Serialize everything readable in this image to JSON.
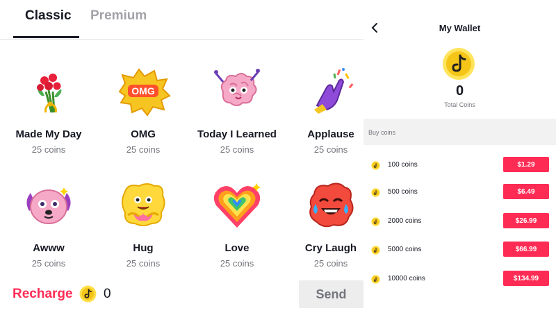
{
  "tabs": [
    {
      "label": "Classic",
      "active": true
    },
    {
      "label": "Premium",
      "active": false
    }
  ],
  "gifts": [
    {
      "name": "Made My Day",
      "price": "25 coins",
      "icon": "rose-bouquet-icon"
    },
    {
      "name": "OMG",
      "price": "25 coins",
      "icon": "omg-burst-icon"
    },
    {
      "name": "Today I Learned",
      "price": "25 coins",
      "icon": "brain-icon"
    },
    {
      "name": "Applause",
      "price": "25 coins",
      "icon": "clapping-hands-icon"
    },
    {
      "name": "Awww",
      "price": "25 coins",
      "icon": "puppy-icon"
    },
    {
      "name": "Hug",
      "price": "25 coins",
      "icon": "hug-icon"
    },
    {
      "name": "Love",
      "price": "25 coins",
      "icon": "rainbow-heart-icon"
    },
    {
      "name": "Cry Laugh",
      "price": "25 coins",
      "icon": "cry-laugh-icon"
    }
  ],
  "footer": {
    "recharge_label": "Recharge",
    "balance": "0",
    "send_label": "Send"
  },
  "wallet": {
    "title": "My Wallet",
    "balance": "0",
    "balance_label": "Total Coins",
    "buy_label": "Buy coins",
    "packages": [
      {
        "coins": "100 coins",
        "price": "$1.29"
      },
      {
        "coins": "500 coins",
        "price": "$6.49"
      },
      {
        "coins": "2000 coins",
        "price": "$26.99"
      },
      {
        "coins": "5000 coins",
        "price": "$66.99"
      },
      {
        "coins": "10000 coins",
        "price": "$134.99"
      }
    ]
  },
  "colors": {
    "accent": "#fe2c55",
    "coin": "#f5c518",
    "text": "#161823",
    "muted": "#73757c"
  }
}
